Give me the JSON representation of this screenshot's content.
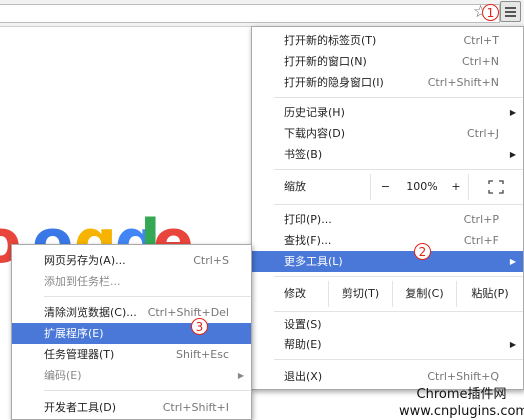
{
  "main_menu": {
    "groups": [
      [
        {
          "label": "打开新的标签页(T)",
          "shortcut": "Ctrl+T"
        },
        {
          "label": "打开新的窗口(N)",
          "shortcut": "Ctrl+N"
        },
        {
          "label": "打开新的隐身窗口(I)",
          "shortcut": "Ctrl+Shift+N"
        }
      ],
      [
        {
          "label": "历史记录(H)",
          "shortcut": ""
        },
        {
          "label": "下载内容(D)",
          "shortcut": "Ctrl+J"
        },
        {
          "label": "书签(B)",
          "shortcut": ""
        }
      ]
    ],
    "zoom": {
      "label": "缩放",
      "minus": "−",
      "value": "100%",
      "plus": "+"
    },
    "group3": [
      {
        "label": "打印(P)...",
        "shortcut": "Ctrl+P"
      },
      {
        "label": "查找(F)...",
        "shortcut": "Ctrl+F"
      },
      {
        "label": "更多工具(L)",
        "shortcut": ""
      }
    ],
    "edit": {
      "label": "修改",
      "cut": "剪切(T)",
      "copy": "复制(C)",
      "paste": "粘贴(P)"
    },
    "group4": [
      {
        "label": "设置(S)",
        "shortcut": ""
      },
      {
        "label": "帮助(E)",
        "shortcut": ""
      }
    ],
    "exit": {
      "label": "退出(X)",
      "shortcut": "Ctrl+Shift+Q"
    }
  },
  "sub_menu": {
    "items": [
      {
        "label": "网页另存为(A)...",
        "shortcut": "Ctrl+S"
      },
      {
        "label": "添加到任务栏...",
        "shortcut": ""
      },
      {
        "label": "清除浏览数据(C)...",
        "shortcut": "Ctrl+Shift+Del"
      },
      {
        "label": "扩展程序(E)",
        "shortcut": ""
      },
      {
        "label": "任务管理器(T)",
        "shortcut": "Shift+Esc"
      },
      {
        "label": "编码(E)",
        "shortcut": ""
      },
      {
        "label": "开发者工具(D)",
        "shortcut": "Ctrl+Shift+I"
      }
    ]
  },
  "badges": {
    "one": "1",
    "two": "2",
    "three": "3"
  },
  "watermark": {
    "line1": "Chrome插件网",
    "line2": "www.cnplugins.com"
  },
  "colors": {
    "highlight": "#4a78d8",
    "badge": "#e2231a"
  }
}
